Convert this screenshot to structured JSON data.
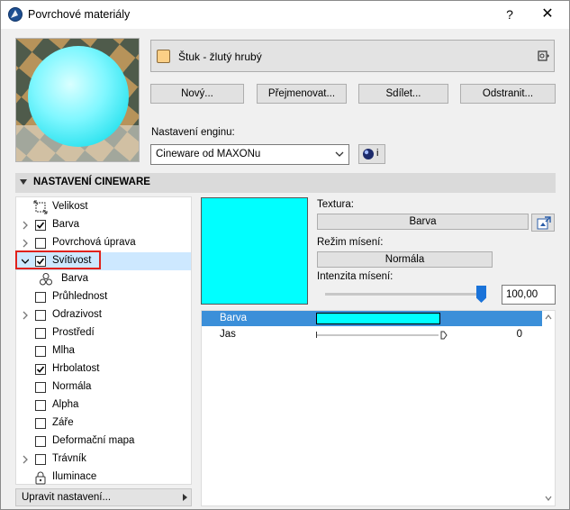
{
  "window": {
    "title": "Povrchové materiály",
    "help_label": "?",
    "close_label": "✕"
  },
  "material": {
    "name": "Štuk - žlutý hrubý",
    "swatch_color": "#fbcf86"
  },
  "actions": {
    "new_label": "Nový...",
    "rename_label": "Přejmenovat...",
    "share_label": "Sdílet...",
    "delete_label": "Odstranit..."
  },
  "engine": {
    "label": "Nastavení enginu:",
    "selected": "Cineware od MAXONu",
    "info_label": "i"
  },
  "section": {
    "title": "NASTAVENÍ CINEWARE"
  },
  "tree": {
    "items": [
      {
        "label": "Velikost",
        "kind": "size-icon",
        "expandable": false
      },
      {
        "label": "Barva",
        "kind": "checkbox",
        "checked": true,
        "expandable": true
      },
      {
        "label": "Povrchová úprava",
        "kind": "checkbox",
        "checked": false,
        "expandable": true
      },
      {
        "label": "Svítivost",
        "kind": "checkbox",
        "checked": true,
        "expandable": true,
        "expanded": true
      },
      {
        "label": "Barva",
        "kind": "channel-icon",
        "child": true
      },
      {
        "label": "Průhlednost",
        "kind": "checkbox",
        "checked": false,
        "expandable": false
      },
      {
        "label": "Odrazivost",
        "kind": "checkbox",
        "checked": false,
        "expandable": true
      },
      {
        "label": "Prostředí",
        "kind": "checkbox",
        "checked": false,
        "expandable": false
      },
      {
        "label": "Mlha",
        "kind": "checkbox",
        "checked": false,
        "expandable": false
      },
      {
        "label": "Hrbolatost",
        "kind": "checkbox",
        "checked": true,
        "expandable": false
      },
      {
        "label": "Normála",
        "kind": "checkbox",
        "checked": false,
        "expandable": false
      },
      {
        "label": "Alpha",
        "kind": "checkbox",
        "checked": false,
        "expandable": false
      },
      {
        "label": "Záře",
        "kind": "checkbox",
        "checked": false,
        "expandable": false
      },
      {
        "label": "Deformační mapa",
        "kind": "checkbox",
        "checked": false,
        "expandable": false
      },
      {
        "label": "Trávník",
        "kind": "checkbox",
        "checked": false,
        "expandable": true
      },
      {
        "label": "Iluminace",
        "kind": "lock-icon",
        "expandable": false
      }
    ],
    "edit_settings_label": "Upravit nastavení..."
  },
  "channel": {
    "color": "#00ffff",
    "texture_label": "Textura:",
    "texture_value": "Barva",
    "blend_mode_label": "Režim mísení:",
    "blend_mode_value": "Normála",
    "blend_intensity_label": "Intenzita mísení:",
    "blend_intensity_value": "100,00",
    "blend_intensity_fraction": 1.0
  },
  "properties": {
    "rows": [
      {
        "name": "Barva",
        "type": "color",
        "color": "#00ffff"
      },
      {
        "name": "Jas",
        "type": "slider",
        "value": "0"
      }
    ]
  }
}
